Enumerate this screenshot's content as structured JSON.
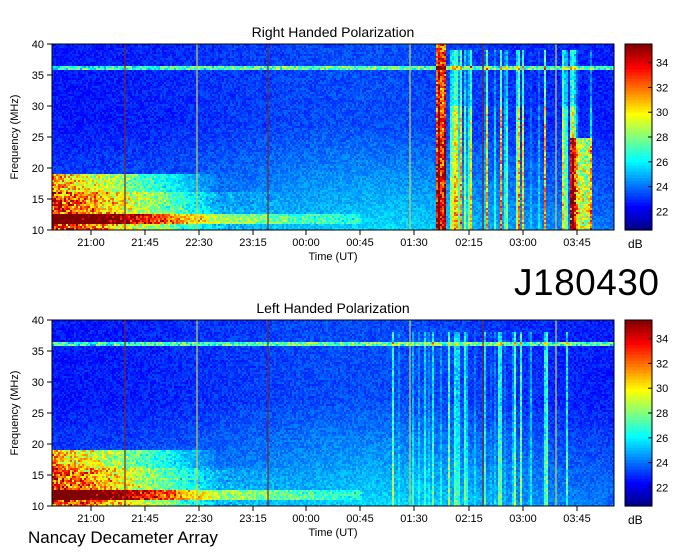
{
  "observation_id": "J180430",
  "footer": "Nancay Decameter Array",
  "colorbar_unit": "dB",
  "chart_data": [
    {
      "type": "heatmap",
      "title": "Right Handed Polarization",
      "xlabel": "Time (UT)",
      "ylabel": "Frequency (MHz)",
      "x_tick_labels": [
        "21:00",
        "21:45",
        "22:30",
        "23:15",
        "00:00",
        "00:45",
        "01:30",
        "02:15",
        "03:00",
        "03:45"
      ],
      "y_tick_labels": [
        "10",
        "15",
        "20",
        "25",
        "30",
        "35",
        "40"
      ],
      "ylim": [
        10,
        40
      ],
      "colorbar_ticks": [
        "22",
        "24",
        "26",
        "28",
        "30",
        "32",
        "34"
      ],
      "colorbar_range": [
        20.5,
        35.5
      ],
      "colormap": "jet"
    },
    {
      "type": "heatmap",
      "title": "Left Handed Polarization",
      "xlabel": "Time (UT)",
      "ylabel": "Frequency (MHz)",
      "x_tick_labels": [
        "21:00",
        "21:45",
        "22:30",
        "23:15",
        "00:00",
        "00:45",
        "01:30",
        "02:15",
        "03:00",
        "03:45"
      ],
      "y_tick_labels": [
        "10",
        "15",
        "20",
        "25",
        "30",
        "35",
        "40"
      ],
      "ylim": [
        10,
        40
      ],
      "colorbar_ticks": [
        "22",
        "24",
        "26",
        "28",
        "30",
        "32",
        "34"
      ],
      "colorbar_range": [
        20.5,
        35.5
      ],
      "colormap": "jet"
    }
  ]
}
